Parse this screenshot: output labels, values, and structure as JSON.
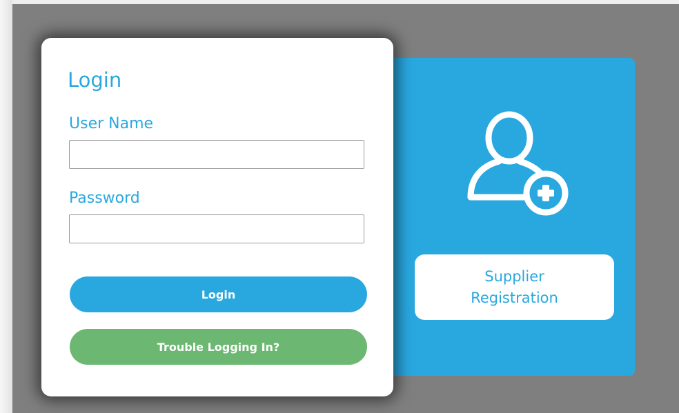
{
  "login": {
    "title": "Login",
    "username_label": "User Name",
    "username_value": "",
    "password_label": "Password",
    "password_value": "",
    "login_button": "Login",
    "trouble_button": "Trouble Logging In?"
  },
  "supplier": {
    "icon": "user-add-icon",
    "button_line1": "Supplier",
    "button_line2": "Registration"
  },
  "colors": {
    "accent_blue": "#29a8e0",
    "trouble_green": "#6cb872",
    "backdrop_gray": "#7f7f7f",
    "card_white": "#ffffff"
  }
}
